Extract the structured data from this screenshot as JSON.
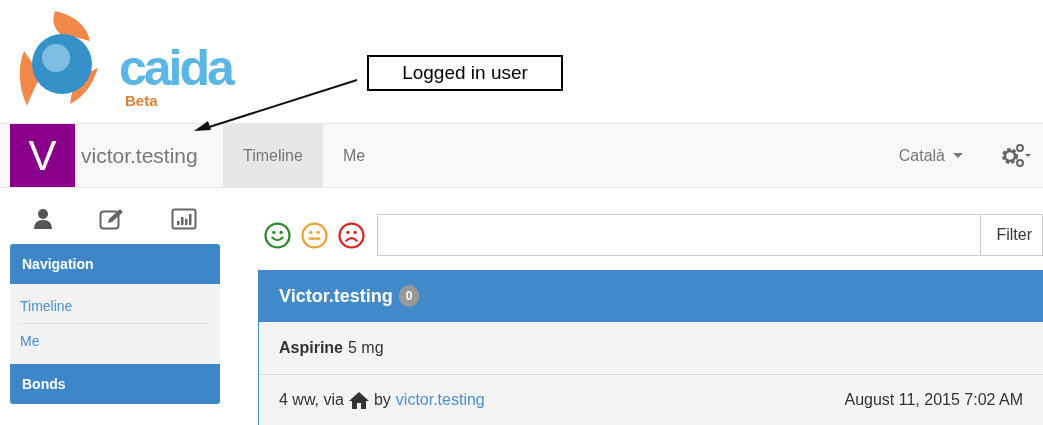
{
  "logo": {
    "wordmark": "caida",
    "tag": "Beta"
  },
  "annotation": {
    "text": "Logged in user"
  },
  "navbar": {
    "avatar_letter": "V",
    "username": "victor.testing",
    "tabs": [
      {
        "label": "Timeline",
        "selected": true
      },
      {
        "label": "Me",
        "selected": false
      }
    ],
    "language": "Català"
  },
  "sidebar": {
    "tabs": [
      {
        "kind": "user"
      },
      {
        "kind": "edit"
      },
      {
        "kind": "chart"
      }
    ],
    "panels": [
      {
        "title": "Navigation",
        "items": [
          "Timeline",
          "Me"
        ]
      },
      {
        "title": "Bonds"
      }
    ]
  },
  "mood_filter": [
    {
      "kind": "happy",
      "color": "#2a8a2a"
    },
    {
      "kind": "neutral",
      "color": "#f0a030"
    },
    {
      "kind": "sad",
      "color": "#e02020"
    }
  ],
  "filter_button": "Filter",
  "timeline": {
    "title": "Victor.testing",
    "count": "0",
    "entries": [
      {
        "name": "Aspirine",
        "dose": "5 mg",
        "meta_prefix": "4 ww, via",
        "meta_by": "by",
        "author": "victor.testing",
        "date": "August 11, 2015 7:02 AM"
      }
    ]
  }
}
